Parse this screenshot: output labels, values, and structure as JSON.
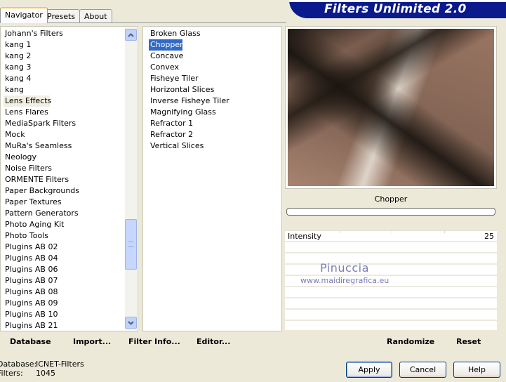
{
  "tabs": [
    "Navigator",
    "Presets",
    "About"
  ],
  "banner_title": "Filters Unlimited 2.0",
  "categories": [
    "Johann's Filters",
    "kang 1",
    "kang 2",
    "kang 3",
    "kang 4",
    "kang",
    "Lens Effects",
    "Lens Flares",
    "MediaSpark Filters",
    "Mock",
    "MuRa's Seamless",
    "Neology",
    "Noise Filters",
    "ORMENTE Filters",
    "Paper Backgrounds",
    "Paper Textures",
    "Pattern Generators",
    "Photo Aging Kit",
    "Photo Tools",
    "Plugins AB 02",
    "Plugins AB 04",
    "Plugins AB 06",
    "Plugins AB 07",
    "Plugins AB 08",
    "Plugins AB 09",
    "Plugins AB 10",
    "Plugins AB 21"
  ],
  "current_category": "Lens Effects",
  "filters": [
    "Broken Glass",
    "Chopper",
    "Concave",
    "Convex",
    "Fisheye Tiler",
    "Horizontal Slices",
    "Inverse Fisheye Tiler",
    "Magnifying Glass",
    "Refractor 1",
    "Refractor 2",
    "Vertical Slices"
  ],
  "selected_filter": "Chopper",
  "preview_label": "Chopper",
  "params": [
    {
      "label": "Intensity",
      "value": "25"
    }
  ],
  "watermark": {
    "name": "Pinuccia",
    "url": "www.maidiregrafica.eu"
  },
  "bottom_links": {
    "database": "Database",
    "import": "Import...",
    "filter_info": "Filter Info...",
    "editor": "Editor...",
    "randomize": "Randomize",
    "reset": "Reset"
  },
  "info": {
    "database_label": "Database:",
    "database_value": "ICNET-Filters",
    "filters_label": "Filters:",
    "filters_value": "1045"
  },
  "buttons": {
    "apply": "Apply",
    "cancel": "Cancel",
    "help": "Help"
  },
  "icons": {
    "scroll_up": "arrow-up-icon",
    "scroll_down": "arrow-down-icon"
  },
  "colors": {
    "selection": "#316ac5",
    "banner": "#0a1a8c",
    "accent_tab": "#ffc83c"
  }
}
